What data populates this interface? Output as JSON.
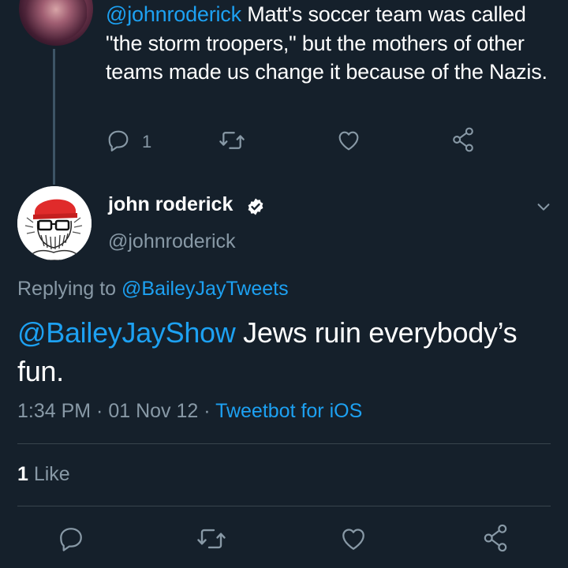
{
  "parent_tweet": {
    "mention": "@johnroderick",
    "text": " Matt's soccer team was called \"the storm troopers,\" but the mothers of other teams made us change it because of the Nazis.",
    "reply_count": "1",
    "icons": [
      "reply-icon",
      "retweet-icon",
      "like-icon",
      "share-icon"
    ]
  },
  "main_tweet": {
    "display_name": "john roderick",
    "handle": "@johnroderick",
    "replying_prefix": "Replying to ",
    "replying_to": "@BaileyJayTweets",
    "mention": "@BaileyJayShow",
    "text": " Jews ruin everybody’s fun.",
    "time": "1:34 PM",
    "separator": " · ",
    "date": "01 Nov 12",
    "client": "Tweetbot for iOS",
    "like_count": "1",
    "like_label": " Like",
    "icons": [
      "reply-icon",
      "retweet-icon",
      "like-icon",
      "share-icon",
      "verified-badge-icon",
      "chevron-down-icon"
    ]
  },
  "colors": {
    "background": "#15202b",
    "accent": "#1da1f2",
    "secondary_text": "#8899a6",
    "divider": "#38444d"
  }
}
